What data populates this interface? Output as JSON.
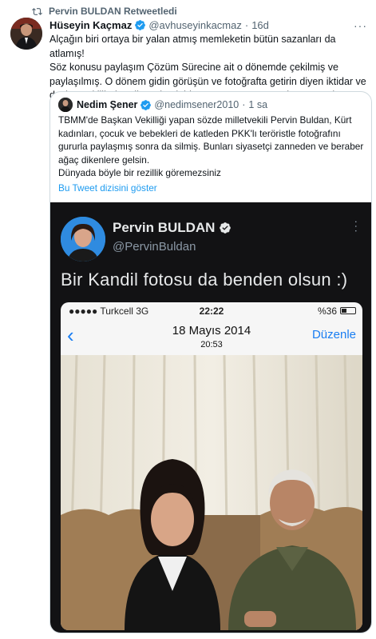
{
  "retweet": {
    "label": "Pervin BULDAN Retweetledi"
  },
  "tweet": {
    "author_name": "Hüseyin Kaçmaz",
    "author_handle": "@avhuseyinkacmaz",
    "separator": "·",
    "time": "16d",
    "text": "Alçağın biri ortaya bir yalan atmış memleketin bütün sazanları da atlamış!\nSöz konusu paylaşım Çözüm Sürecine ait o dönemde çekilmiş ve paylaşılmış. O dönem gidin görüşün ve fotoğrafta getirin diyen iktidar ve devlet yetkililerine diyecek tek bir sözünüz var mı sözde gazeteci!"
  },
  "quote": {
    "author_name": "Nedim Şener",
    "author_handle": "@nedimsener2010",
    "separator": "·",
    "time": "1 sa",
    "text": "TBMM'de Başkan Vekilliği yapan sözde milletvekili Pervin Buldan, Kürt kadınları, çocuk ve bebekleri de katleden PKK'lı teröristle fotoğrafını gururla paylaşmış sonra da silmiş. Bunları siyasetçi zanneden ve beraber ağaç dikenlere gelsin.\nDünyada böyle bir rezillik göremezsiniz",
    "thread_link": "Bu Tweet dizisini göster"
  },
  "screenshot": {
    "name": "Pervin BULDAN",
    "handle": "@PervinBuldan",
    "text": "Bir Kandil fotosu da benden olsun :)",
    "phone": {
      "carrier": "●●●●● Turkcell  3G",
      "clock": "22:22",
      "battery": "%36",
      "date": "18 Mayıs 2014",
      "time": "20:53",
      "back": "‹",
      "edit": "Düzenle"
    }
  },
  "colors": {
    "accent": "#1d9bf0",
    "ios_blue": "#1a7ef2",
    "muted": "#536471"
  }
}
